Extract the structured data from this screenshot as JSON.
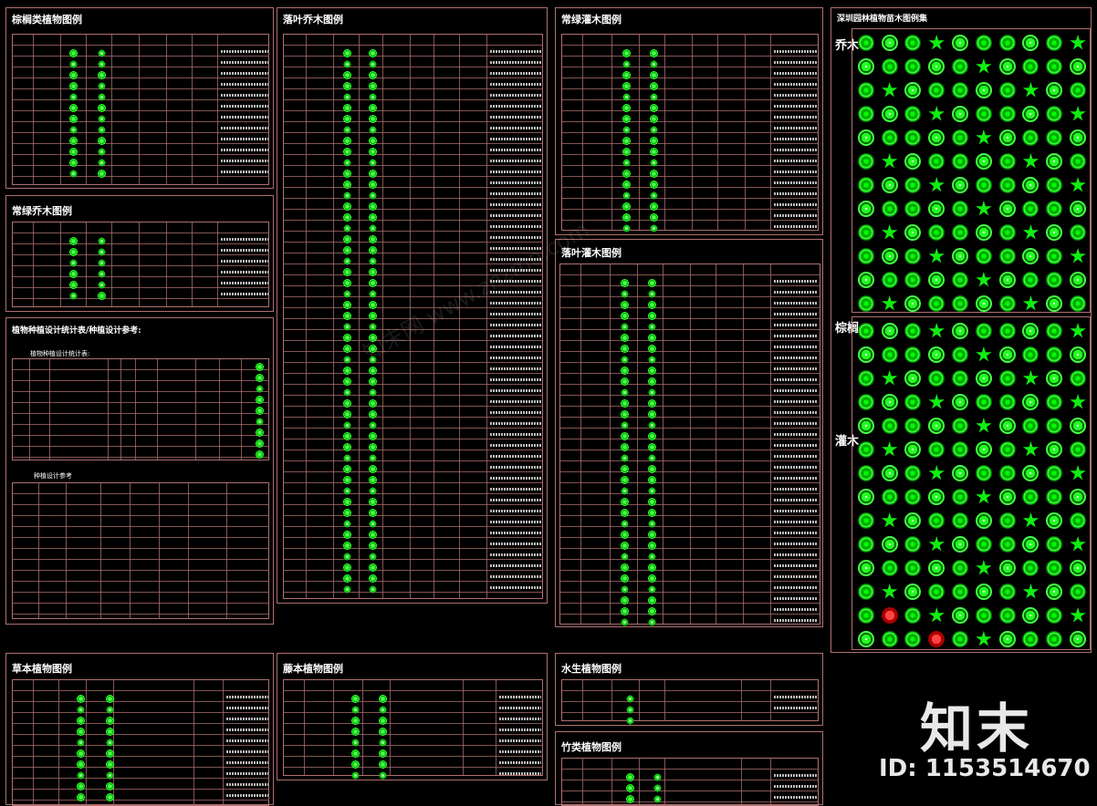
{
  "panels": {
    "palm": {
      "title": "棕榈类植物图例"
    },
    "evergreen_tree": {
      "title": "常绿乔木图例"
    },
    "planting_stats": {
      "title": "植物种植设计统计表/种植设计参考:",
      "subtitle": "植物种植设计统计表:",
      "reference": "种植设计参考"
    },
    "deciduous_tree": {
      "title": "落叶乔木图例"
    },
    "evergreen_shrub": {
      "title": "常绿灌木图例"
    },
    "deciduous_shrub": {
      "title": "落叶灌木图例"
    },
    "shenzhen": {
      "title": "深圳园林植物苗木图例集",
      "section_trees": "乔木",
      "section_palms": "棕榈",
      "section_shrubs": "灌木"
    },
    "herb": {
      "title": "草本植物图例"
    },
    "vine": {
      "title": "藤本植物图例"
    },
    "aquatic": {
      "title": "水生植物图例"
    },
    "bamboo": {
      "title": "竹类植物图例"
    }
  },
  "watermark": {
    "logo": "知末",
    "id": "ID: 1153514670",
    "site": "知末网 www.znzmo.com"
  }
}
